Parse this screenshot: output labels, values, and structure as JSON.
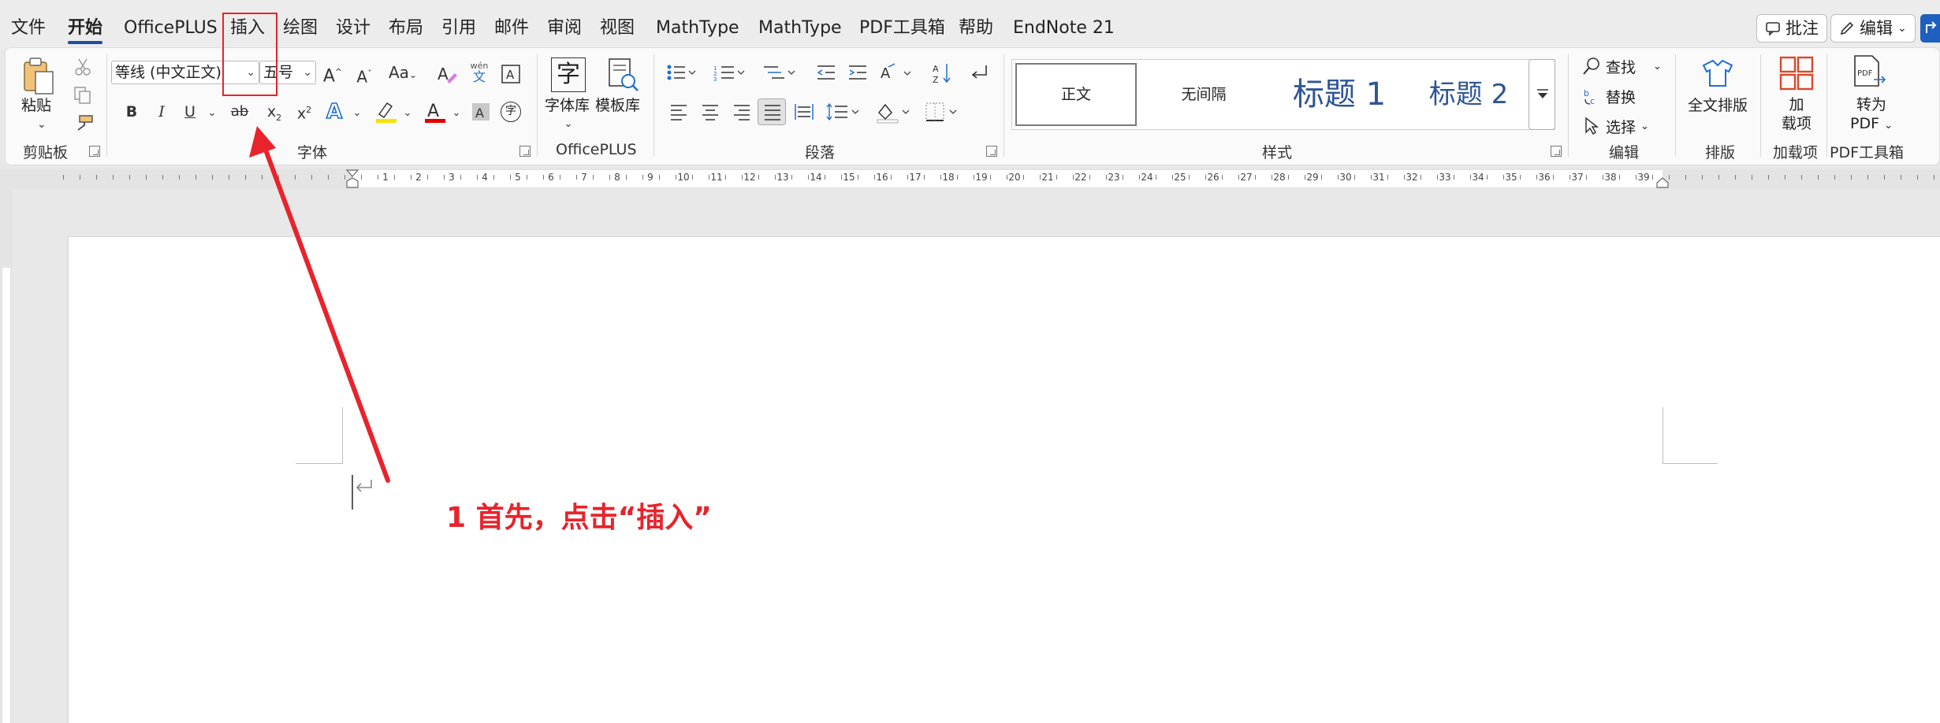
{
  "tabs": [
    "文件",
    "开始",
    "OfficePLUS",
    "插入",
    "绘图",
    "设计",
    "布局",
    "引用",
    "邮件",
    "审阅",
    "视图",
    "MathType",
    "MathType",
    "PDF工具箱",
    "帮助",
    "EndNote 21"
  ],
  "top_buttons": {
    "comment": "批注",
    "edit": "编辑"
  },
  "clipboard": {
    "paste": "粘贴",
    "group": "剪贴板"
  },
  "font": {
    "name": "等线 (中文正文)",
    "size": "五号",
    "group": "字体",
    "phonetic_top": "wén",
    "phonetic_bottom": "文",
    "encircle": "字"
  },
  "officeplus": {
    "fontlib": "字体库",
    "templatelib": "模板库",
    "group": "OfficePLUS",
    "glyph": "字"
  },
  "paragraph": {
    "group": "段落"
  },
  "styles": {
    "items": [
      "正文",
      "无间隔",
      "标题 1",
      "标题 2"
    ],
    "group": "样式"
  },
  "editing": {
    "find": "查找",
    "replace": "替换",
    "select": "选择",
    "group": "编辑"
  },
  "layout": {
    "btn": "全文排版",
    "group": "排版"
  },
  "addins": {
    "btn_line1": "加",
    "btn_line2": "载项",
    "group": "加载项"
  },
  "pdf": {
    "btn_line1": "转为",
    "btn_line2": "PDF",
    "group": "PDF工具箱",
    "icon_text": "PDF"
  },
  "ruler_numbers": [
    "1",
    "2",
    "3",
    "4",
    "5",
    "6",
    "7",
    "8",
    "9",
    "10",
    "11",
    "12",
    "13",
    "14",
    "15",
    "16",
    "17",
    "18",
    "19",
    "20",
    "21",
    "22",
    "23",
    "24",
    "25",
    "26",
    "27",
    "28",
    "29",
    "30",
    "31",
    "32",
    "33",
    "34",
    "35",
    "36",
    "37",
    "38",
    "39"
  ],
  "annotation": "1 首先，点击“插入”",
  "colors": {
    "accent": "#1f4e9c",
    "annotation_red": "#e8232c",
    "highlight_yellow": "#f4e400",
    "font_red": "#e00000",
    "heading_blue": "#2f5597"
  }
}
